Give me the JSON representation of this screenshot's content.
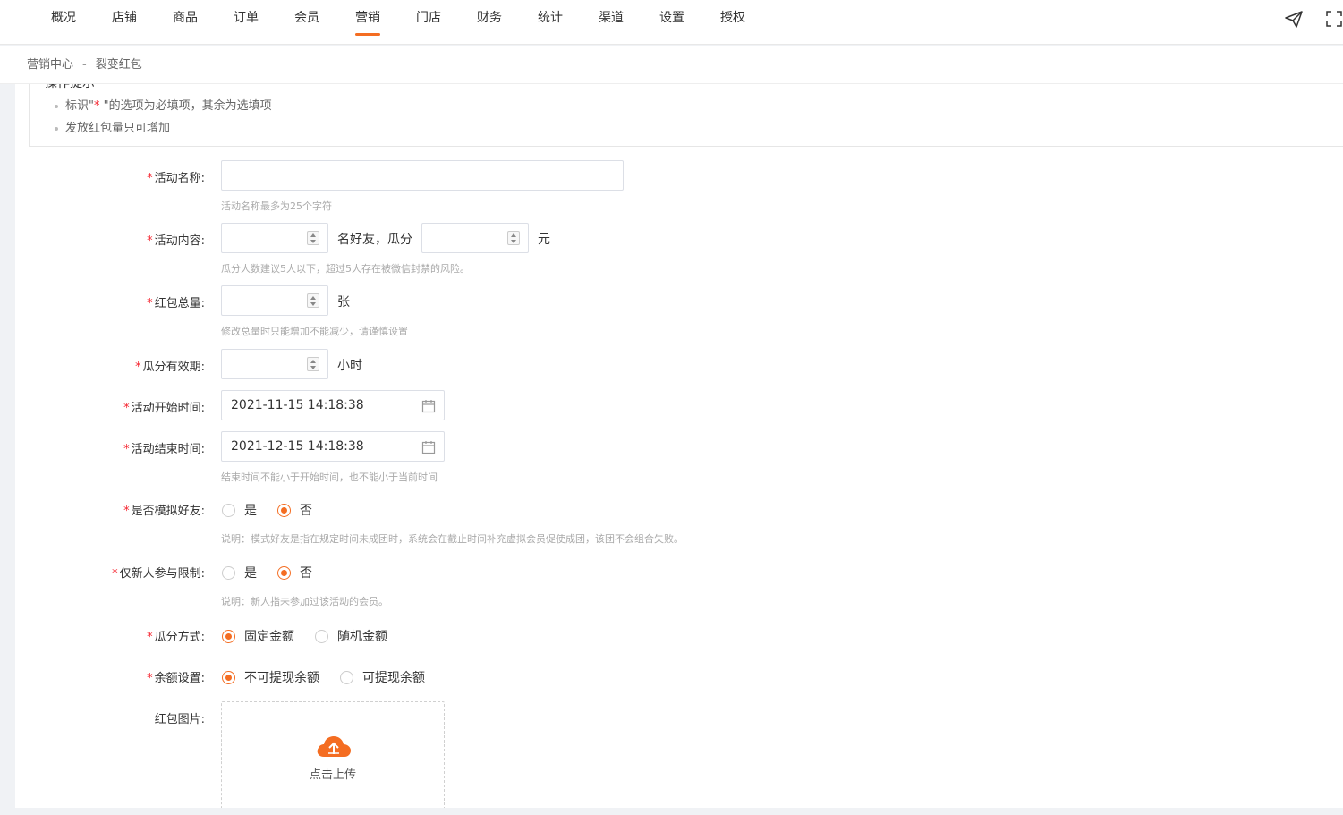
{
  "nav": {
    "items": [
      "概况",
      "店铺",
      "商品",
      "订单",
      "会员",
      "营销",
      "门店",
      "财务",
      "统计",
      "渠道",
      "设置",
      "授权"
    ],
    "active": "营销"
  },
  "breadcrumb": {
    "parent": "营销中心",
    "separator": "-",
    "current": "裂变红包"
  },
  "tips": {
    "title": "操作提示",
    "item1_prefix": "标识\"",
    "item1_star": "*",
    "item1_suffix": " \"的选项为必填项，其余为选填项",
    "item2": "发放红包量只可增加"
  },
  "form": {
    "required_mark": "*",
    "name": {
      "label": "活动名称:",
      "value": "",
      "hint": "活动名称最多为25个字符"
    },
    "content": {
      "label": "活动内容:",
      "unit1": "名好友，瓜分",
      "unit2": "元",
      "hint": "瓜分人数建议5人以下，超过5人存在被微信封禁的风险。"
    },
    "total": {
      "label": "红包总量:",
      "unit": "张",
      "hint": "修改总量时只能增加不能减少，请谨慎设置"
    },
    "validity": {
      "label": "瓜分有效期:",
      "unit": "小时"
    },
    "start": {
      "label": "活动开始时间:",
      "value": "2021-11-15 14:18:38"
    },
    "end": {
      "label": "活动结束时间:",
      "value": "2021-12-15 14:18:38",
      "hint": "结束时间不能小于开始时间，也不能小于当前时间"
    },
    "simulate": {
      "label": "是否模拟好友:",
      "yes": "是",
      "no": "否",
      "selected": "否",
      "hint": "说明：模式好友是指在规定时间未成团时，系统会在截止时间补充虚拟会员促使成团，该团不会组合失败。"
    },
    "newonly": {
      "label": "仅新人参与限制:",
      "yes": "是",
      "no": "否",
      "selected": "否",
      "hint": "说明：新人指未参加过该活动的会员。"
    },
    "split": {
      "label": "瓜分方式:",
      "fixed": "固定金额",
      "random": "随机金额",
      "selected": "固定金额"
    },
    "balance": {
      "label": "余额设置:",
      "no_withdraw": "不可提现余额",
      "withdraw": "可提现余额",
      "selected": "不可提现余额"
    },
    "image": {
      "label": "红包图片:",
      "upload_text": "点击上传"
    }
  },
  "colors": {
    "accent": "#f46d22",
    "required": "#f5222d"
  },
  "icons": {
    "send": "send-icon",
    "fullscreen": "fullscreen-icon",
    "calendar": "calendar-icon",
    "upload": "cloud-upload-icon"
  }
}
